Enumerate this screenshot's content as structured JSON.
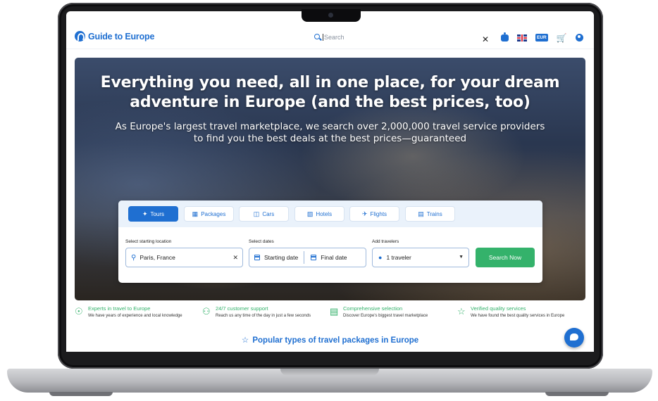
{
  "brand": {
    "logo_text": "Guide to Europe",
    "color": "#1f6fd1"
  },
  "header": {
    "search_placeholder": "Search",
    "close": "✕",
    "currency": "EUR",
    "icons": [
      "search-icon",
      "robot-icon",
      "uk-flag-icon",
      "currency-icon",
      "cart-icon",
      "user-icon"
    ]
  },
  "hero": {
    "title_line1": "Everything you need, all in one place, for your dream",
    "title_line2": "adventure in Europe (and the best prices, too)",
    "sub_line1": "As Europe's largest travel marketplace, we search over 2,000,000 travel service providers",
    "sub_line2": "to find you the best deals at the best prices—guaranteed"
  },
  "tabs": [
    {
      "label": "Tours",
      "icon": "hiker-icon",
      "active": true
    },
    {
      "label": "Packages",
      "icon": "map-icon",
      "active": false
    },
    {
      "label": "Cars",
      "icon": "car-icon",
      "active": false
    },
    {
      "label": "Hotels",
      "icon": "hotel-icon",
      "active": false
    },
    {
      "label": "Flights",
      "icon": "plane-icon",
      "active": false
    },
    {
      "label": "Trains",
      "icon": "train-icon",
      "active": false
    }
  ],
  "form": {
    "location_label": "Select starting location",
    "location_value": "Paris, France",
    "dates_label": "Select dates",
    "start_date": "Starting date",
    "final_date": "Final date",
    "travelers_label": "Add travelers",
    "travelers_value": "1 traveler",
    "submit": "Search Now"
  },
  "features": [
    {
      "title": "Experts in travel to Europe",
      "desc": "We have years of experience and local knowledge",
      "icon": "compass-icon"
    },
    {
      "title": "24/7 customer support",
      "desc": "Reach us any time of the day in just a few seconds",
      "icon": "support-icon"
    },
    {
      "title": "Comprehensive selection",
      "desc": "Discover Europe's biggest travel marketplace",
      "icon": "catalog-icon"
    },
    {
      "title": "Verified quality services",
      "desc": "We have found the best quality services in Europe",
      "icon": "star-icon"
    }
  ],
  "popular_heading": "Popular types of travel packages in Europe",
  "colors": {
    "primary": "#1f6fd1",
    "success": "#34b26b"
  }
}
